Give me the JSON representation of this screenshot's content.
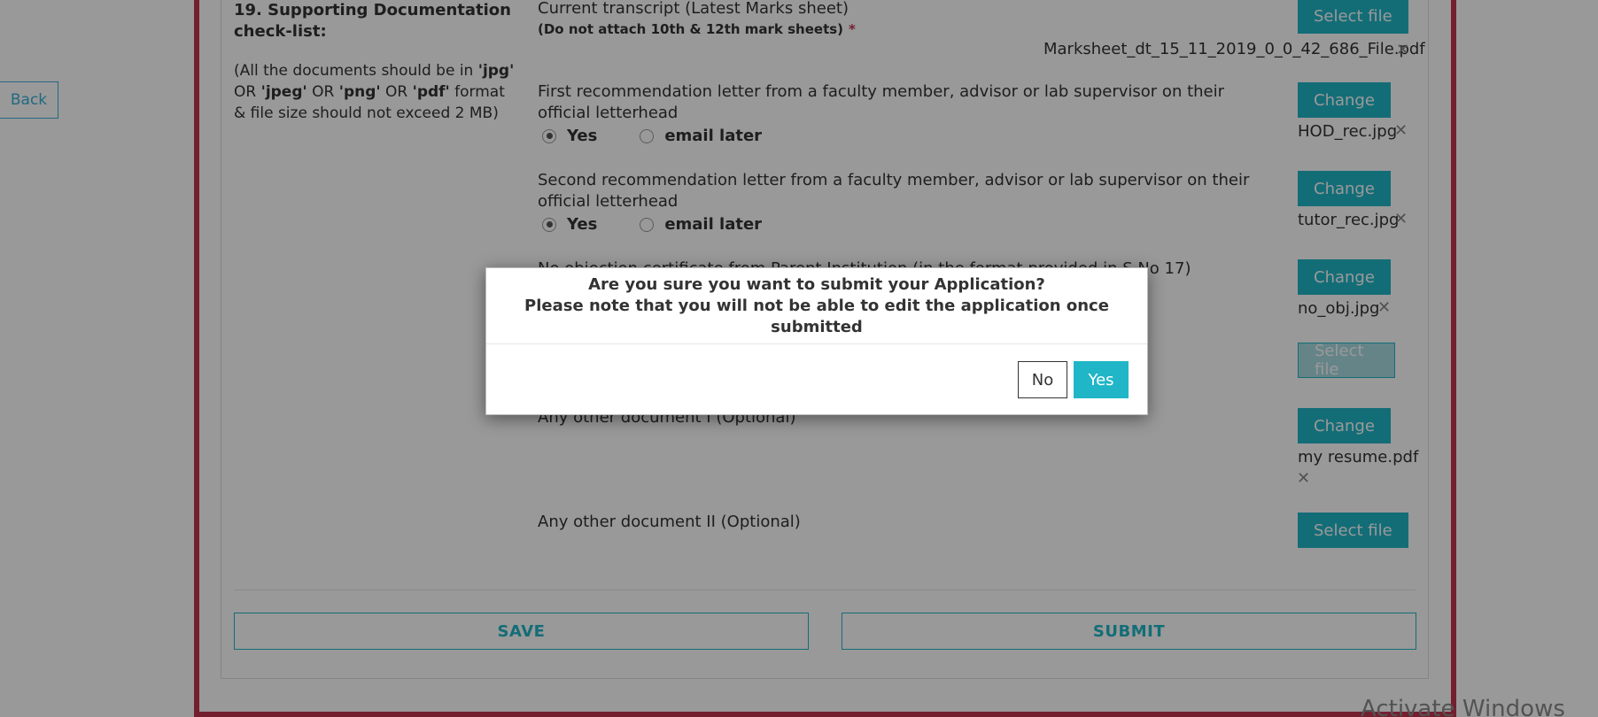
{
  "back_label": "Back",
  "section": {
    "title": "19. Supporting Documentation check-list:",
    "note_parts": [
      "(All the documents should be in ",
      "'jpg'",
      " OR ",
      "'jpeg'",
      " OR ",
      "'png'",
      " OR ",
      "'pdf'",
      " format & file size should not exceed 2 MB)"
    ]
  },
  "documents": [
    {
      "label": "Current transcript (Latest Marks sheet)",
      "sublabel": "(Do not attach 10th & 12th mark sheets)",
      "required_mark": "*",
      "button": "Select file",
      "file": "Marksheet_dt_15_11_2019_0_0_42_686_File.pdf"
    },
    {
      "label": "First recommendation letter from a faculty member, advisor or lab supervisor on their official letterhead",
      "radio_yes": "Yes",
      "radio_later": "email later",
      "button": "Change",
      "file": "HOD_rec.jpg"
    },
    {
      "label": "Second recommendation letter from a faculty member, advisor or lab supervisor on their official letterhead",
      "radio_yes": "Yes",
      "radio_later": "email later",
      "button": "Change",
      "file": "tutor_rec.jpg"
    },
    {
      "label": "No objection certificate from Parent Institution (in the format provided in S.No 17)",
      "button": "Change",
      "file": "no_obj.jpg"
    },
    {
      "button": "Select file"
    },
    {
      "label": "Any other document I (Optional)",
      "button": "Change",
      "file": "my resume.pdf"
    },
    {
      "label": "Any other document II (Optional)",
      "button": "Select file"
    }
  ],
  "close_glyph": "✕",
  "actions": {
    "save": "SAVE",
    "submit": "SUBMIT"
  },
  "watermark": "Activate Windows",
  "modal": {
    "line1": "Are you sure you want to submit your Application?",
    "line2": "Please note that you will not be able to edit the application once submitted",
    "no": "No",
    "yes": "Yes"
  },
  "colors": {
    "accent": "#20b6c7",
    "frame": "#c0344f",
    "back_link": "#3ab0d8"
  }
}
